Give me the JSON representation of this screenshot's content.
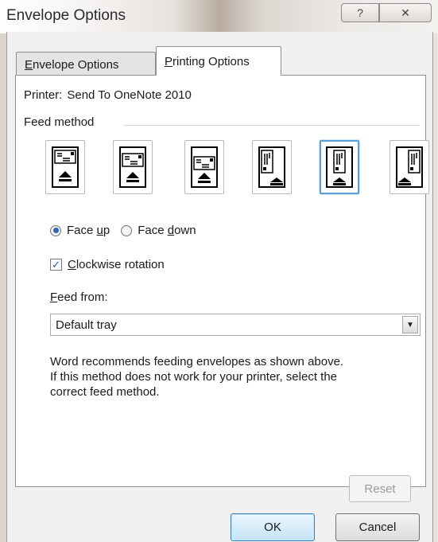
{
  "window": {
    "title": "Envelope Options",
    "help_glyph": "?",
    "close_glyph": "✕"
  },
  "tabs": [
    {
      "label": "Envelope Options",
      "mnemonic": "E",
      "rest": "nvelope Options",
      "selected": false
    },
    {
      "label": "Printing Options",
      "mnemonic": "P",
      "rest": "rinting Options",
      "selected": true
    }
  ],
  "printer": {
    "label": "Printer:",
    "name": "Send To OneNote 2010"
  },
  "feed_method": {
    "label": "Feed method",
    "options": [
      {
        "name": "horizontal-left",
        "icon": "envelope-horizontal-left-icon",
        "selected": false
      },
      {
        "name": "horizontal-center",
        "icon": "envelope-horizontal-center-icon",
        "selected": false
      },
      {
        "name": "horizontal-right",
        "icon": "envelope-horizontal-right-icon",
        "selected": false
      },
      {
        "name": "vertical-left",
        "icon": "envelope-vertical-left-icon",
        "selected": false
      },
      {
        "name": "vertical-center",
        "icon": "envelope-vertical-center-icon",
        "selected": true
      },
      {
        "name": "vertical-right",
        "icon": "envelope-vertical-right-icon",
        "selected": false
      }
    ],
    "selected_color": "#5b9fd8"
  },
  "face": {
    "up_before": "Face ",
    "up_mnemonic": "u",
    "up_after": "p",
    "down_before": "Face ",
    "down_mnemonic": "d",
    "down_after": "own",
    "selected": "up"
  },
  "rotation": {
    "mnemonic": "C",
    "rest": "lockwise rotation",
    "checked": true,
    "check_glyph": "✓"
  },
  "feed_from": {
    "mnemonic": "F",
    "rest": "eed from:",
    "value": "Default tray",
    "arrow_glyph": "▼"
  },
  "info": {
    "line1": "Word recommends feeding envelopes as shown above.",
    "line2": "If this method does not work for your printer, select the",
    "line3": "correct feed method."
  },
  "buttons": {
    "reset": "Reset",
    "ok": "OK",
    "cancel": "Cancel"
  },
  "colors": {
    "ok_border": "#3c7fb1",
    "radio_dot": "#2e67b3"
  }
}
